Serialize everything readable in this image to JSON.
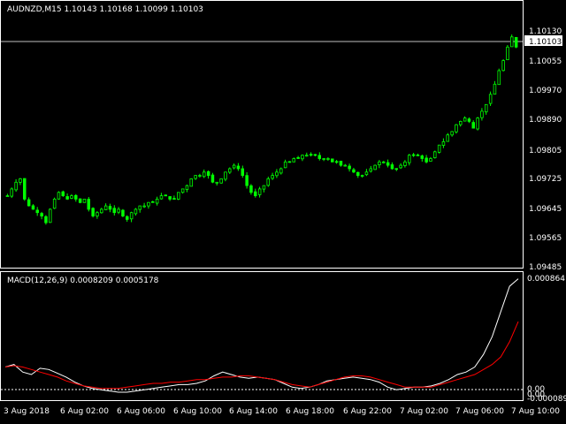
{
  "window": {
    "symbol_header": "AUDNZD,M15  1.10143 1.10168 1.10099 1.10103"
  },
  "main": {
    "price_ticks": [
      "1.10130",
      "1.10055",
      "1.09970",
      "1.09890",
      "1.09805",
      "1.09725",
      "1.09645",
      "1.09565",
      "1.09485"
    ],
    "current_price": "1.10103",
    "colors": {
      "bull": "#00ff00",
      "bear": "#00ff00",
      "background": "#000000",
      "price_line": "#c0c0c0"
    }
  },
  "indicator": {
    "header": "MACD(12,26,9) 0.0008209 0.0005178",
    "ticks": {
      "top": "0.000864",
      "zero_a": "0.00",
      "zero_b": "0.00",
      "bottom": "-0.000089"
    },
    "colors": {
      "macd": "#ffffff",
      "signal": "#ff0000"
    }
  },
  "time_axis": {
    "labels": [
      "3 Aug 2018",
      "6 Aug 02:00",
      "6 Aug 06:00",
      "6 Aug 10:00",
      "6 Aug 14:00",
      "6 Aug 18:00",
      "6 Aug 22:00",
      "7 Aug 02:00",
      "7 Aug 06:00",
      "7 Aug 10:00"
    ]
  },
  "chart_data": {
    "type": "candlestick",
    "price_range": [
      1.09455,
      1.102
    ],
    "macd_range": [
      -8.9e-05,
      0.000864
    ],
    "close_series": [
      1.0966,
      1.0968,
      1.097,
      1.0971,
      1.0965,
      1.0963,
      1.0962,
      1.0961,
      1.096,
      1.0958,
      1.0962,
      1.0965,
      1.0967,
      1.0966,
      1.0965,
      1.0966,
      1.0965,
      1.0964,
      1.0965,
      1.0962,
      1.096,
      1.0961,
      1.0962,
      1.0963,
      1.0962,
      1.0961,
      1.0962,
      1.096,
      1.0959,
      1.0961,
      1.0962,
      1.0963,
      1.0963,
      1.0964,
      1.0964,
      1.0965,
      1.0966,
      1.0966,
      1.0965,
      1.0965,
      1.0967,
      1.0968,
      1.0969,
      1.0971,
      1.0972,
      1.0972,
      1.0973,
      1.0972,
      1.097,
      1.097,
      1.0971,
      1.0973,
      1.0974,
      1.0975,
      1.0974,
      1.0972,
      1.0969,
      1.0967,
      1.0966,
      1.0968,
      1.0969,
      1.0971,
      1.0972,
      1.0973,
      1.0974,
      1.0976,
      1.0976,
      1.0977,
      1.0977,
      1.0978,
      1.0978,
      1.0978,
      1.0978,
      1.0977,
      1.0977,
      1.0977,
      1.0976,
      1.0976,
      1.0975,
      1.0975,
      1.0974,
      1.0973,
      1.0972,
      1.0972,
      1.0973,
      1.0974,
      1.0975,
      1.0976,
      1.0976,
      1.0975,
      1.0974,
      1.0974,
      1.0975,
      1.0976,
      1.0978,
      1.0978,
      1.0978,
      1.0977,
      1.0976,
      1.0977,
      1.0979,
      1.0981,
      1.0982,
      1.0984,
      1.0985,
      1.0987,
      1.0988,
      1.0989,
      1.0988,
      1.0986,
      1.0989,
      1.0991,
      1.0993,
      1.0996,
      1.0999,
      1.1003,
      1.1006,
      1.101,
      1.1013,
      1.101
    ],
    "macd_series": [
      0.00016,
      0.00018,
      0.00012,
      0.0001,
      0.00015,
      0.00014,
      0.00011,
      8e-05,
      4e-05,
      1e-05,
      -1e-05,
      -2e-05,
      -3e-05,
      -4e-05,
      -4e-05,
      -3e-05,
      -2e-05,
      -1e-05,
      0.0,
      1e-05,
      2e-05,
      2e-05,
      3e-05,
      5e-05,
      9e-05,
      0.00012,
      0.0001,
      8e-05,
      7e-05,
      8e-05,
      7e-05,
      6e-05,
      3e-05,
      0.0,
      -1e-05,
      0.0,
      2e-05,
      5e-05,
      6e-05,
      7e-05,
      8e-05,
      7e-05,
      6e-05,
      4e-05,
      0.0,
      -2e-05,
      -1e-05,
      0.0,
      0.0,
      1e-05,
      3e-05,
      6e-05,
      0.0001,
      0.00012,
      0.00016,
      0.00026,
      0.0004,
      0.0006,
      0.0008,
      0.00086
    ],
    "signal_series": [
      0.00016,
      0.00017,
      0.00016,
      0.00014,
      0.00012,
      0.0001,
      8e-05,
      5e-05,
      3e-05,
      1e-05,
      0.0,
      -1e-05,
      -1e-05,
      -1e-05,
      0.0,
      1e-05,
      2e-05,
      3e-05,
      3e-05,
      4e-05,
      4e-05,
      5e-05,
      6e-05,
      6e-05,
      7e-05,
      8e-05,
      8e-05,
      9e-05,
      9e-05,
      8e-05,
      7e-05,
      6e-05,
      4e-05,
      2e-05,
      1e-05,
      0.0,
      2e-05,
      4e-05,
      6e-05,
      8e-05,
      9e-05,
      9e-05,
      8e-05,
      6e-05,
      4e-05,
      2e-05,
      0.0,
      0.0,
      0.0,
      0.0,
      2e-05,
      4e-05,
      6e-05,
      8e-05,
      0.0001,
      0.00014,
      0.00018,
      0.00024,
      0.00036,
      0.00052
    ]
  }
}
